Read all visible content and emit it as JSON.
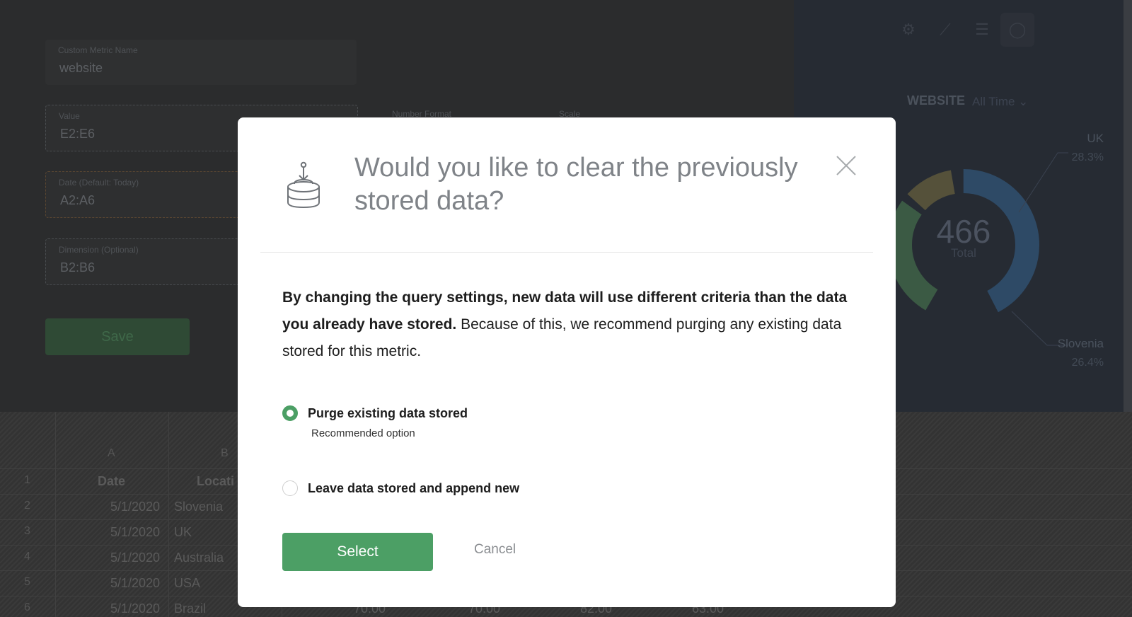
{
  "background": {
    "fields": {
      "metric_name_label": "Custom Metric Name",
      "metric_name_value": "website",
      "value_label": "Value",
      "value_value": "E2:E6",
      "date_label": "Date (Default: Today)",
      "date_value": "A2:A6",
      "dimension_label": "Dimension (Optional)",
      "dimension_value": "B2:B6",
      "number_format_label": "Number Format",
      "scale_label": "Scale"
    },
    "save_label": "Save",
    "widget": {
      "title": "WEBSITE",
      "period": "All Time ⌄",
      "total_value": "466",
      "total_label": "Total",
      "slices": [
        {
          "label": "UK",
          "percent": "28.3%"
        },
        {
          "label": "Slovenia",
          "percent": "26.4%"
        }
      ],
      "colors": [
        "#2e4a66",
        "#3b5a44",
        "#55513a"
      ]
    },
    "sheet": {
      "columns": [
        "A",
        "B"
      ],
      "row_numbers": [
        "1",
        "2",
        "3",
        "4",
        "5",
        "6"
      ],
      "header_row": [
        "Date",
        "Locati"
      ],
      "rows": [
        [
          "5/1/2020",
          "Slovenia"
        ],
        [
          "5/1/2020",
          "UK"
        ],
        [
          "5/1/2020",
          "Australia"
        ],
        [
          "5/1/2020",
          "USA"
        ],
        [
          "5/1/2020",
          "Brazil"
        ]
      ],
      "last_row_extra": [
        "70.00",
        "70.00",
        "82.00",
        "63.00"
      ]
    }
  },
  "modal": {
    "title": "Would you like to clear the previously stored data?",
    "body_bold": "By changing the query settings, new data will use different criteria than the data you already have stored.",
    "body_regular": " Because of this, we recommend purging any existing data stored for this metric.",
    "options": [
      {
        "label": "Purge existing data stored",
        "sub": "Recommended option",
        "checked": true
      },
      {
        "label": "Leave data stored and append new",
        "checked": false
      }
    ],
    "select_label": "Select",
    "cancel_label": "Cancel",
    "accent_color": "#4c9f65"
  }
}
